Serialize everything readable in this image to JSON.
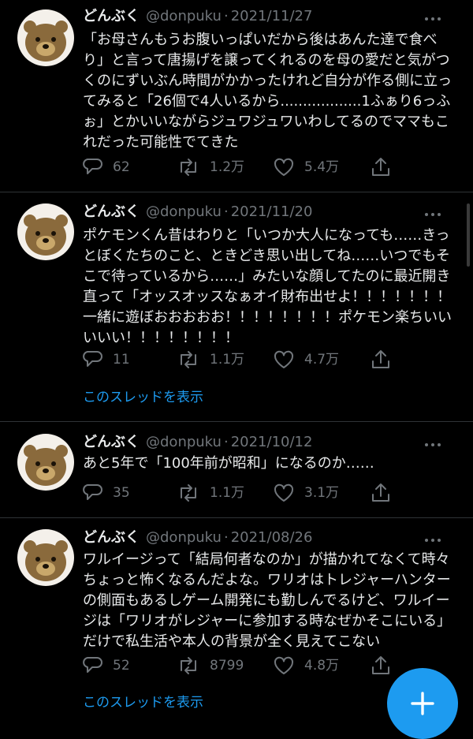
{
  "colors": {
    "background": "#000000",
    "text": "#e7e9ea",
    "muted": "#71767b",
    "link": "#1d9bf0",
    "divider": "#2f3336",
    "avatar_bg": "#f4f0ea",
    "bear": "#8a6a3c"
  },
  "icons": {
    "more": "more-dots-icon",
    "reply": "reply-icon",
    "retweet": "retweet-icon",
    "like": "like-icon",
    "share": "share-icon",
    "compose": "compose-plus-icon"
  },
  "tweets": [
    {
      "name": "どんぶく",
      "handle": "@donpuku",
      "sep": "·",
      "date": "2021/11/27",
      "text": "「お母さんもうお腹いっぱいだから後はあんた達で食べり」と言って唐揚げを譲ってくれるのを母の愛だと気がつくのにずいぶん時間がかかったけれど自分が作る側に立ってみると「26個で4人いるから..................1ふぁり6っふぉ」とかいいながらジュワジュワいわしてるのでママもこれだった可能性でてきた",
      "replies": "62",
      "retweets": "1.2万",
      "likes": "5.4万"
    },
    {
      "name": "どんぶく",
      "handle": "@donpuku",
      "sep": "·",
      "date": "2021/11/20",
      "text": "ポケモンくん昔はわりと「いつか大人になっても……きっとぼくたちのこと、ときどき思い出してね……いつでもそこで待っているから……」みたいな顔してたのに最近開き直って「オッスオッスなぁオイ財布出せよ！！！！！！！一緒に遊ぼおおおおお！！！！！！！！ポケモン楽ちいいいいい！！！！！！！！",
      "replies": "11",
      "retweets": "1.1万",
      "likes": "4.7万",
      "thread": "このスレッドを表示"
    },
    {
      "name": "どんぶく",
      "handle": "@donpuku",
      "sep": "·",
      "date": "2021/10/12",
      "text": "あと5年で「100年前が昭和」になるのか……",
      "replies": "35",
      "retweets": "1.1万",
      "likes": "3.1万"
    },
    {
      "name": "どんぶく",
      "handle": "@donpuku",
      "sep": "·",
      "date": "2021/08/26",
      "text": "ワルイージって「結局何者なのか」が描かれてなくて時々ちょっと怖くなるんだよな。ワリオはトレジャーハンターの側面もあるしゲーム開発にも勤しんでるけど、ワルイージは「ワリオがレジャーに参加する時なぜかそこにいる」だけで私生活や本人の背景が全く見えてこない",
      "replies": "52",
      "retweets": "8799",
      "likes": "4.8万",
      "thread": "このスレッドを表示"
    }
  ]
}
